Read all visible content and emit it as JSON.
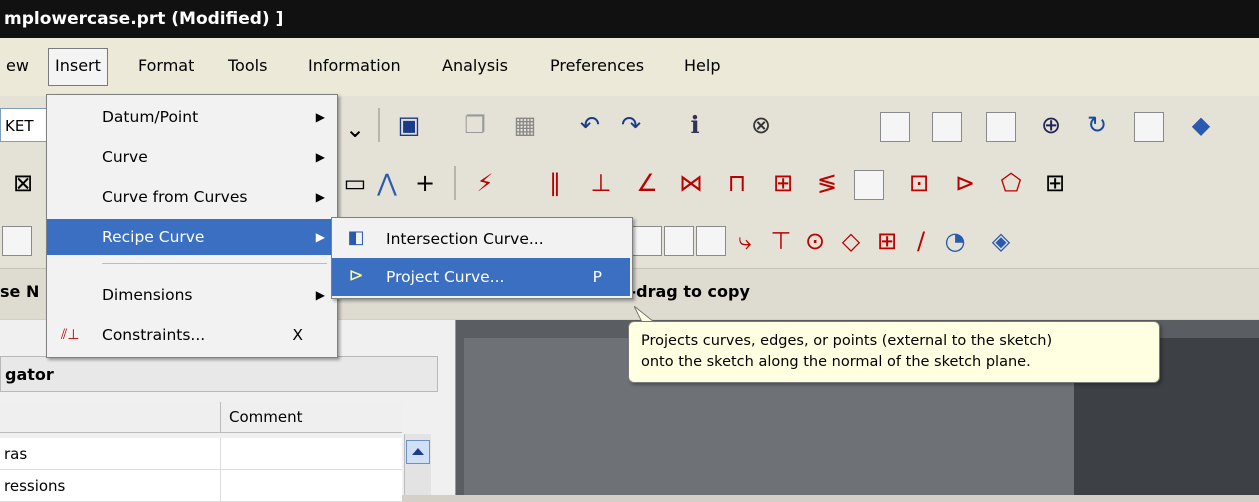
{
  "window": {
    "title": "mplowercase.prt (Modified) ]"
  },
  "menubar": {
    "items": [
      "ew",
      "Insert",
      "Format",
      "Tools",
      "Information",
      "Analysis",
      "Preferences",
      "Help"
    ],
    "active": "Insert"
  },
  "toolbar": {
    "sketch_combo_value": "KET"
  },
  "insert_menu": {
    "items": [
      {
        "label": "Datum/Point",
        "submenu": true
      },
      {
        "label": "Curve",
        "submenu": true
      },
      {
        "label": "Curve from Curves",
        "submenu": true
      },
      {
        "label": "Recipe Curve",
        "submenu": true,
        "highlighted": true
      },
      {
        "label": "Dimensions",
        "submenu": true
      },
      {
        "label": "Constraints...",
        "shortcut": "X"
      }
    ]
  },
  "recipe_submenu": {
    "items": [
      {
        "label": "Intersection Curve...",
        "icon": "intersection-curve-icon"
      },
      {
        "label": "Project Curve...",
        "shortcut": "P",
        "icon": "project-curve-icon",
        "highlighted": true
      }
    ]
  },
  "status": {
    "left_fragment": "se N",
    "cue_fragment": "s-drag to copy"
  },
  "tooltip": {
    "line1": "Projects curves, edges, or points (external to the sketch)",
    "line2": "onto the sketch along the normal of the sketch plane."
  },
  "navigator": {
    "title": "gator",
    "column_comment": "Comment",
    "rows": [
      "ras",
      "ressions"
    ]
  },
  "colors": {
    "highlight": "#3b6fc2",
    "tooltip_bg": "#ffffe1",
    "titlebar": "#111111"
  }
}
